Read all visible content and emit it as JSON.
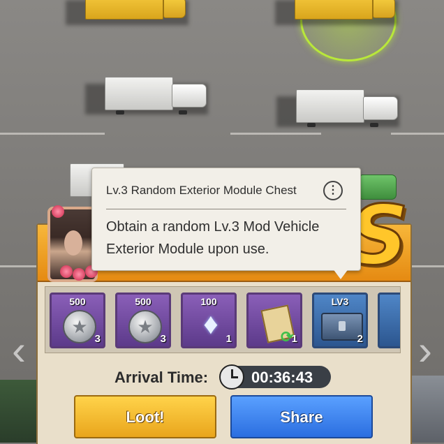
{
  "tooltip": {
    "title": "Lv.3 Random Exterior Module Chest",
    "info_symbol": "⋮",
    "description": "Obtain a random Lv.3 Mod Vehicle Exterior Module upon use."
  },
  "rewards": [
    {
      "amount": "500",
      "count": "3",
      "icon": "silver-coin-icon",
      "tier": "purple"
    },
    {
      "amount": "500",
      "count": "3",
      "icon": "silver-coin-icon",
      "tier": "purple"
    },
    {
      "amount": "100",
      "count": "1",
      "icon": "diamond-icon",
      "tier": "purple"
    },
    {
      "amount": "",
      "count": "1",
      "icon": "wanted-poster-icon",
      "tier": "purple"
    },
    {
      "amount": "LV3",
      "count": "2",
      "icon": "module-chest-icon",
      "tier": "blue"
    }
  ],
  "arrival": {
    "label": "Arrival Time:",
    "time": "00:36:43"
  },
  "buttons": {
    "loot": "Loot!",
    "share": "Share"
  },
  "nav": {
    "prev": "‹",
    "next": "›"
  },
  "banner": {
    "letter": "S"
  },
  "colors": {
    "loot": "#f2b830",
    "share": "#3d86f0",
    "panel_header": "#ef9f22",
    "target_ring": "#b9e83a"
  }
}
